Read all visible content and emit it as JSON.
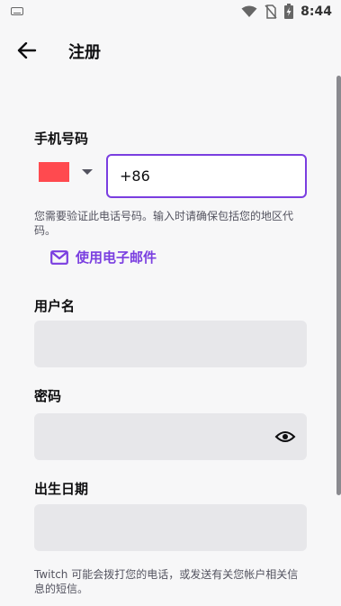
{
  "status_bar": {
    "time": "8:44",
    "icons": [
      "keyboard-icon",
      "wifi-icon",
      "no-sim-icon",
      "battery-charging-icon"
    ]
  },
  "app_bar": {
    "back_icon": "arrow-left-icon",
    "title": "注册"
  },
  "form": {
    "phone": {
      "label": "手机号码",
      "country_flag_color": "#ff4a4f",
      "value": "+86",
      "hint": "您需要验证此电话号码。输入时请确保包括您的地区代码。"
    },
    "use_email_link": {
      "icon": "mail-icon",
      "label": "使用电子邮件"
    },
    "username": {
      "label": "用户名",
      "value": ""
    },
    "password": {
      "label": "密码",
      "value": "",
      "toggle_icon": "eye-icon"
    },
    "birthdate": {
      "label": "出生日期",
      "value": ""
    },
    "disclaimer": "Twitch 可能会拨打您的电话，或发送有关您帐户相关信息的短信。"
  },
  "colors": {
    "accent": "#7a3ee0",
    "field_bg": "#e7e7ea",
    "background": "#f7f7f8"
  }
}
